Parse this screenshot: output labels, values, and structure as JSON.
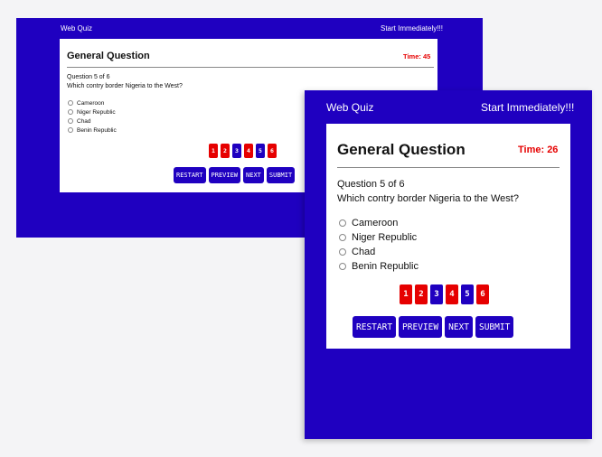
{
  "header": {
    "app_name": "Web Quiz",
    "tagline": "Start Immediately!!!"
  },
  "window_back": {
    "title": "General Question",
    "timer": "Time: 45",
    "question_progress": "Question 5 of 6",
    "question_text": "Which contry border Nigeria to the West?",
    "options": [
      "Cameroon",
      "Niger Republic",
      "Chad",
      "Benin Republic"
    ],
    "pages": [
      {
        "label": "1",
        "color": "#e60000"
      },
      {
        "label": "2",
        "color": "#e60000"
      },
      {
        "label": "3",
        "color": "#1f00c0"
      },
      {
        "label": "4",
        "color": "#e60000"
      },
      {
        "label": "5",
        "color": "#1f00c0"
      },
      {
        "label": "6",
        "color": "#e60000"
      }
    ],
    "buttons": {
      "restart": "RESTART",
      "preview": "PREVIEW",
      "next": "NEXT",
      "submit": "SUBMIT"
    }
  },
  "window_front": {
    "title": "General Question",
    "timer": "Time: 26",
    "question_progress": "Question 5 of 6",
    "question_text": "Which contry border Nigeria to the West?",
    "options": [
      "Cameroon",
      "Niger Republic",
      "Chad",
      "Benin Republic"
    ],
    "pages": [
      {
        "label": "1",
        "color": "#e60000"
      },
      {
        "label": "2",
        "color": "#e60000"
      },
      {
        "label": "3",
        "color": "#1f00c0"
      },
      {
        "label": "4",
        "color": "#e60000"
      },
      {
        "label": "5",
        "color": "#1f00c0"
      },
      {
        "label": "6",
        "color": "#e60000"
      }
    ],
    "buttons": {
      "restart": "RESTART",
      "preview": "PREVIEW",
      "next": "NEXT",
      "submit": "SUBMIT"
    }
  },
  "colors": {
    "panel": "#1f00c0",
    "accent_red": "#e60000",
    "card": "#ffffff"
  }
}
